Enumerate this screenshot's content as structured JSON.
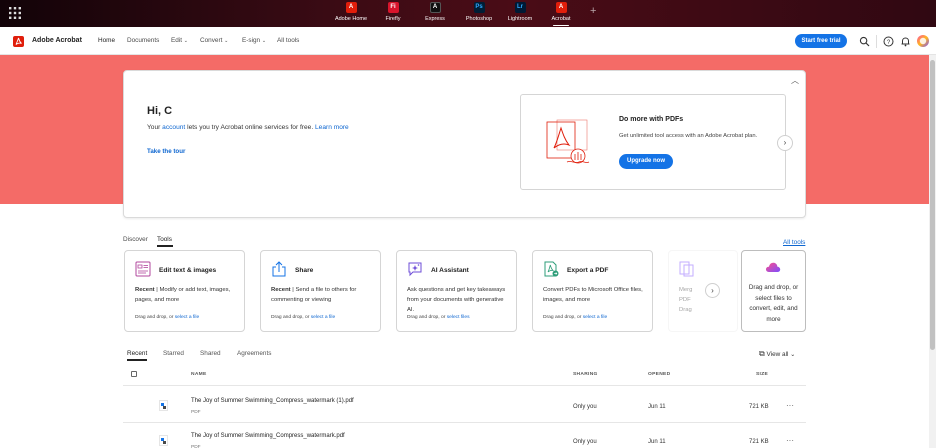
{
  "appbar": {
    "apps": [
      {
        "label": "Adobe Home",
        "glyph": "A",
        "color": "#e01e0b"
      },
      {
        "label": "Firefly",
        "glyph": "Fi",
        "color": "#d9142c"
      },
      {
        "label": "Express",
        "glyph": "A",
        "color": "#111111"
      },
      {
        "label": "Photoshop",
        "glyph": "Ps",
        "color": "#001e36"
      },
      {
        "label": "Lightroom",
        "glyph": "Lr",
        "color": "#001a35"
      },
      {
        "label": "Acrobat",
        "glyph": "A",
        "color": "#e01e0b"
      }
    ],
    "add_glyph": "+"
  },
  "nav": {
    "brand": "Adobe Acrobat",
    "items": [
      "Home",
      "Documents",
      "Edit",
      "Convert",
      "E-sign",
      "All tools"
    ],
    "trial_button": "Start free trial"
  },
  "hero": {
    "greeting": "Hi, C",
    "intro_before": "Your ",
    "intro_link1": "account",
    "intro_middle": " lets you try Acrobat online services for free. ",
    "intro_link2": "Learn more",
    "tour_link": "Take the tour",
    "promo_title": "Do more with PDFs",
    "promo_desc": "Get unlimited tool access with an Adobe Acrobat plan.",
    "promo_button": "Upgrade now"
  },
  "tools_section": {
    "tabs": [
      "Discover",
      "Tools"
    ],
    "active_tab": "Tools",
    "all_tools": "All tools",
    "cards": [
      {
        "title": "Edit text & images",
        "recent": "Recent",
        "desc": "Modify or add text, images, pages, and more",
        "drop": "Drag and drop, or ",
        "link": "select a file"
      },
      {
        "title": "Share",
        "recent": "Recent",
        "desc": "Send a file to others for commenting or viewing",
        "drop": "Drag and drop, or ",
        "link": "select a file"
      },
      {
        "title": "AI Assistant",
        "recent": "",
        "desc": "Ask questions and get key takeaways from your documents with generative AI.",
        "drop": "Drag and drop, or ",
        "link": "select files"
      },
      {
        "title": "Export a PDF",
        "recent": "",
        "desc": "Convert PDFs to Microsoft Office files, images, and more",
        "drop": "Drag and drop, or ",
        "link": "select a file"
      }
    ],
    "ghost_text": "Merg PDF Drag",
    "dropzone_text": "Drag and drop, or select files to convert, edit, and more"
  },
  "files_section": {
    "tabs": [
      "Recent",
      "Starred",
      "Shared",
      "Agreements"
    ],
    "active_tab": "Recent",
    "view_all": "View all",
    "columns": [
      "NAME",
      "SHARING",
      "OPENED",
      "SIZE"
    ],
    "rows": [
      {
        "name": "The Joy of Summer Swimming_Compress_watermark (1).pdf",
        "type": "PDF",
        "sharing": "Only you",
        "opened": "Jun 11",
        "size": "721 KB"
      },
      {
        "name": "The Joy of Summer Swimming_Compress_watermark.pdf",
        "type": "PDF",
        "sharing": "Only you",
        "opened": "Jun 11",
        "size": "721 KB"
      }
    ]
  },
  "colors": {
    "hero_bg": "#f46b67",
    "accent": "#1473e6",
    "link": "#0d66d0",
    "acrobat_red": "#e01e0b"
  }
}
